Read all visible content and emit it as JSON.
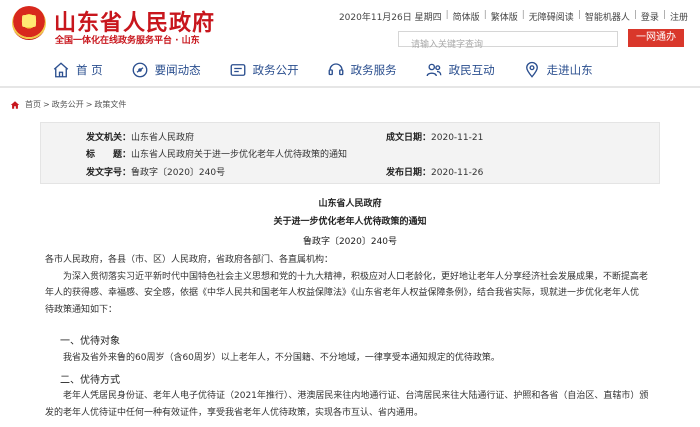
{
  "header": {
    "site_title": "山东省人民政府",
    "site_subtitle": "全国一体化在线政务服务平台 · 山东",
    "date": "2020年11月26日 星期四",
    "links": [
      "简体版",
      "繁体版",
      "无障碍阅读",
      "智能机器人",
      "登录",
      "注册"
    ],
    "search_placeholder": "请输入关键字查询",
    "search_button": "一网通办"
  },
  "nav": {
    "items": [
      {
        "label": "首 页",
        "icon": "home-icon"
      },
      {
        "label": "要闻动态",
        "icon": "news-icon"
      },
      {
        "label": "政务公开",
        "icon": "document-icon"
      },
      {
        "label": "政务服务",
        "icon": "service-icon"
      },
      {
        "label": "政民互动",
        "icon": "people-icon"
      },
      {
        "label": "走进山东",
        "icon": "map-icon"
      }
    ]
  },
  "breadcrumb": [
    "首页",
    "政务公开",
    "政策文件"
  ],
  "info": {
    "issuer_label": "发文机关：",
    "issuer": "山东省人民政府",
    "date_label": "成文日期：",
    "date": "2020-11-21",
    "title_label": "标　　题：",
    "title": "山东省人民政府关于进一步优化老年人优待政策的通知",
    "number_label": "发文字号：",
    "number": "鲁政字〔2020〕240号",
    "publish_label": "发布日期：",
    "publish": "2020-11-26"
  },
  "document": {
    "org": "山东省人民政府",
    "title": "关于进一步优化老年人优待政策的通知",
    "number": "鲁政字〔2020〕240号",
    "salutation": "各市人民政府，各县（市、区）人民政府，省政府各部门、各直属机构：",
    "para1_line1": "为深入贯彻落实习近平新时代中国特色社会主义思想和党的十九大精神，积极应对人口老龄化，更好地让老年人分享经济社会发展成果，不断提高老",
    "para1_line2": "年人的获得感、幸福感、安全感，依据《中华人民共和国老年人权益保障法》《山东省老年人权益保障条例》，结合我省实际，现就进一步优化老年人优",
    "para1_line3": "待政策通知如下：",
    "section1": "一、优待对象",
    "para2": "我省及省外来鲁的60周岁（含60周岁）以上老年人，不分国籍、不分地域，一律享受本通知规定的优待政策。",
    "section2": "二、优待方式",
    "para3_line1": "老年人凭居民身份证、老年人电子优待证（2021年推行）、港澳居民来往内地通行证、台湾居民来往大陆通行证、护照和各省（自治区、直辖市）颁",
    "para3_line2": "发的老年人优待证中任何一种有效证件，享受我省老年人优待政策，实现各市互认、省内通用。"
  },
  "colors": {
    "brand_red": "#c8161d",
    "nav_blue": "#2b4f8f",
    "button_red": "#d9372b"
  }
}
